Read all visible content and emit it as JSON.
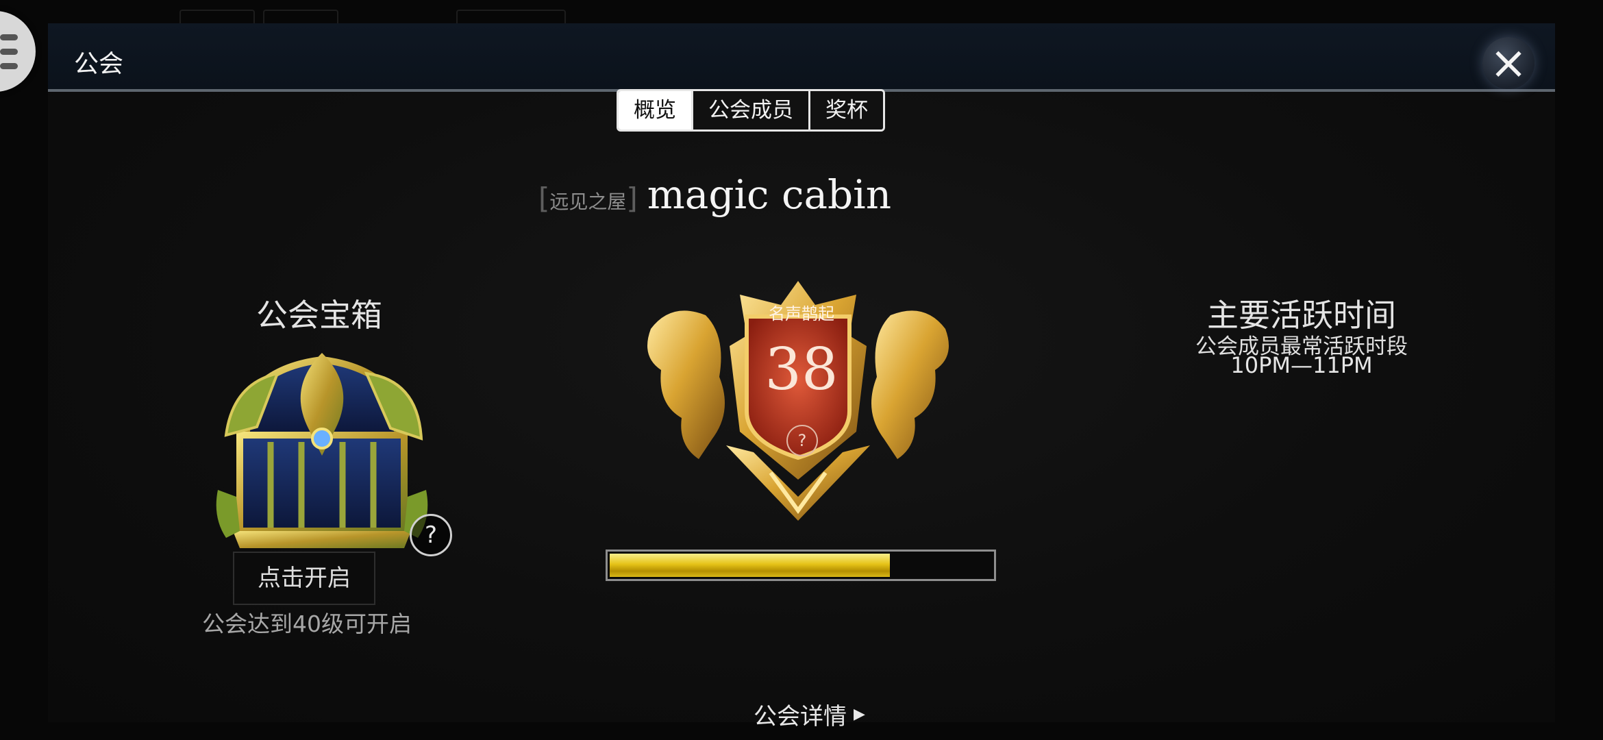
{
  "header": {
    "title": "公会",
    "close_icon": "close-icon"
  },
  "menu": {
    "icon": "hamburger-menu-icon"
  },
  "tabs": [
    {
      "label": "概览",
      "selected": true
    },
    {
      "label": "公会成员",
      "selected": false
    },
    {
      "label": "奖杯",
      "selected": false
    }
  ],
  "guild": {
    "tag": "远见之屋",
    "tag_open": "[",
    "tag_close": "]",
    "name": "magic cabin"
  },
  "chest": {
    "heading": "公会宝箱",
    "help": "?",
    "open_button": "点击开启",
    "note": "公会达到40级可开启"
  },
  "crest": {
    "caption": "名声鹊起",
    "level": "38",
    "help": "?",
    "progress": 0.73
  },
  "activity": {
    "heading": "主要活跃时间",
    "subtitle": "公会成员最常活跃时段",
    "time_range": "10PM—11PM"
  },
  "footer": {
    "details_label": "公会详情",
    "arrow_icon": "triangle-right-icon"
  },
  "colors": {
    "accent_gold": "#e6c318",
    "crest_red": "#c23a22",
    "panel_bg": "#0e0e0e"
  }
}
